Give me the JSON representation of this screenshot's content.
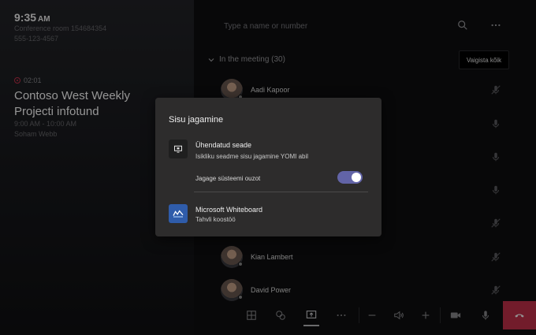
{
  "left": {
    "clock": "9:35",
    "ampm": "AM",
    "room": "Conference room 154684354",
    "phone": "555-123-4567",
    "timer": "02:01",
    "title_line1": "Contoso West Weekly",
    "title_line2": "Projecti infotund",
    "time_range": "9:00 AM - 10:00 AM",
    "organizer": "Soham Webb"
  },
  "right": {
    "search_placeholder": "Type a name or number",
    "section_label": "In the meeting (30)",
    "mute_all_label": "Vaigista kõik",
    "participants": [
      {
        "name": "Aadi Kapoor"
      },
      {
        "name": "Kian Lambert"
      },
      {
        "name": "David Power"
      }
    ]
  },
  "dialog": {
    "title": "Sisu jagamine",
    "device_title": "Ühendatud seade",
    "device_subtitle": "Isikliku seadme sisu jagamine YOMI abil",
    "system_audio_label": "Jagage süsteemi ouzot",
    "system_audio_on": true,
    "whiteboard_title": "Microsoft Whiteboard",
    "whiteboard_subtitle": "Tahvli koostöö"
  },
  "toolbar": {
    "icons": [
      "layout-icon",
      "chat-bubble-icon",
      "share-screen-icon",
      "more-options-icon",
      "volume-down-icon",
      "speaker-icon",
      "volume-up-icon",
      "camera-icon",
      "microphone-icon",
      "hang-up-icon"
    ]
  },
  "colors": {
    "accent": "#6264a7",
    "hangup": "#c4314b",
    "dialog_bg": "#2d2c2c",
    "whiteboard_tile": "#2f5caa"
  }
}
